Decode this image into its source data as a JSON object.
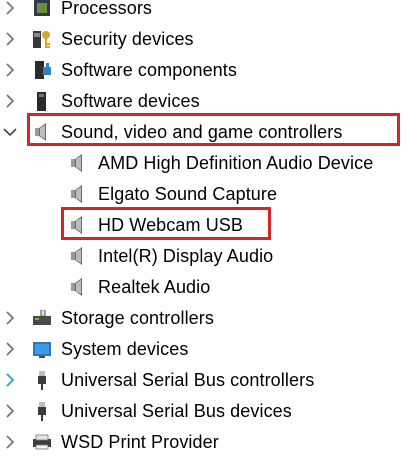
{
  "tree": {
    "items": [
      {
        "label": "Processors",
        "icon": "processor-icon"
      },
      {
        "label": "Security devices",
        "icon": "security-device-icon"
      },
      {
        "label": "Software components",
        "icon": "software-component-icon"
      },
      {
        "label": "Software devices",
        "icon": "software-device-icon"
      },
      {
        "label": "Sound, video and game controllers",
        "icon": "speaker-icon",
        "expanded": true
      },
      {
        "label": "AMD High Definition Audio Device",
        "icon": "speaker-icon"
      },
      {
        "label": "Elgato Sound Capture",
        "icon": "speaker-icon"
      },
      {
        "label": "HD Webcam USB",
        "icon": "speaker-icon"
      },
      {
        "label": "Intel(R) Display Audio",
        "icon": "speaker-icon"
      },
      {
        "label": "Realtek Audio",
        "icon": "speaker-icon"
      },
      {
        "label": "Storage controllers",
        "icon": "storage-controller-icon"
      },
      {
        "label": "System devices",
        "icon": "system-devices-icon"
      },
      {
        "label": "Universal Serial Bus controllers",
        "icon": "usb-icon"
      },
      {
        "label": "Universal Serial Bus devices",
        "icon": "usb-icon"
      },
      {
        "label": "WSD Print Provider",
        "icon": "printer-icon"
      }
    ]
  },
  "colors": {
    "highlight": "#d0272b",
    "chevron": "#6f6f6f",
    "chevron_active": "#2a9fd6"
  }
}
